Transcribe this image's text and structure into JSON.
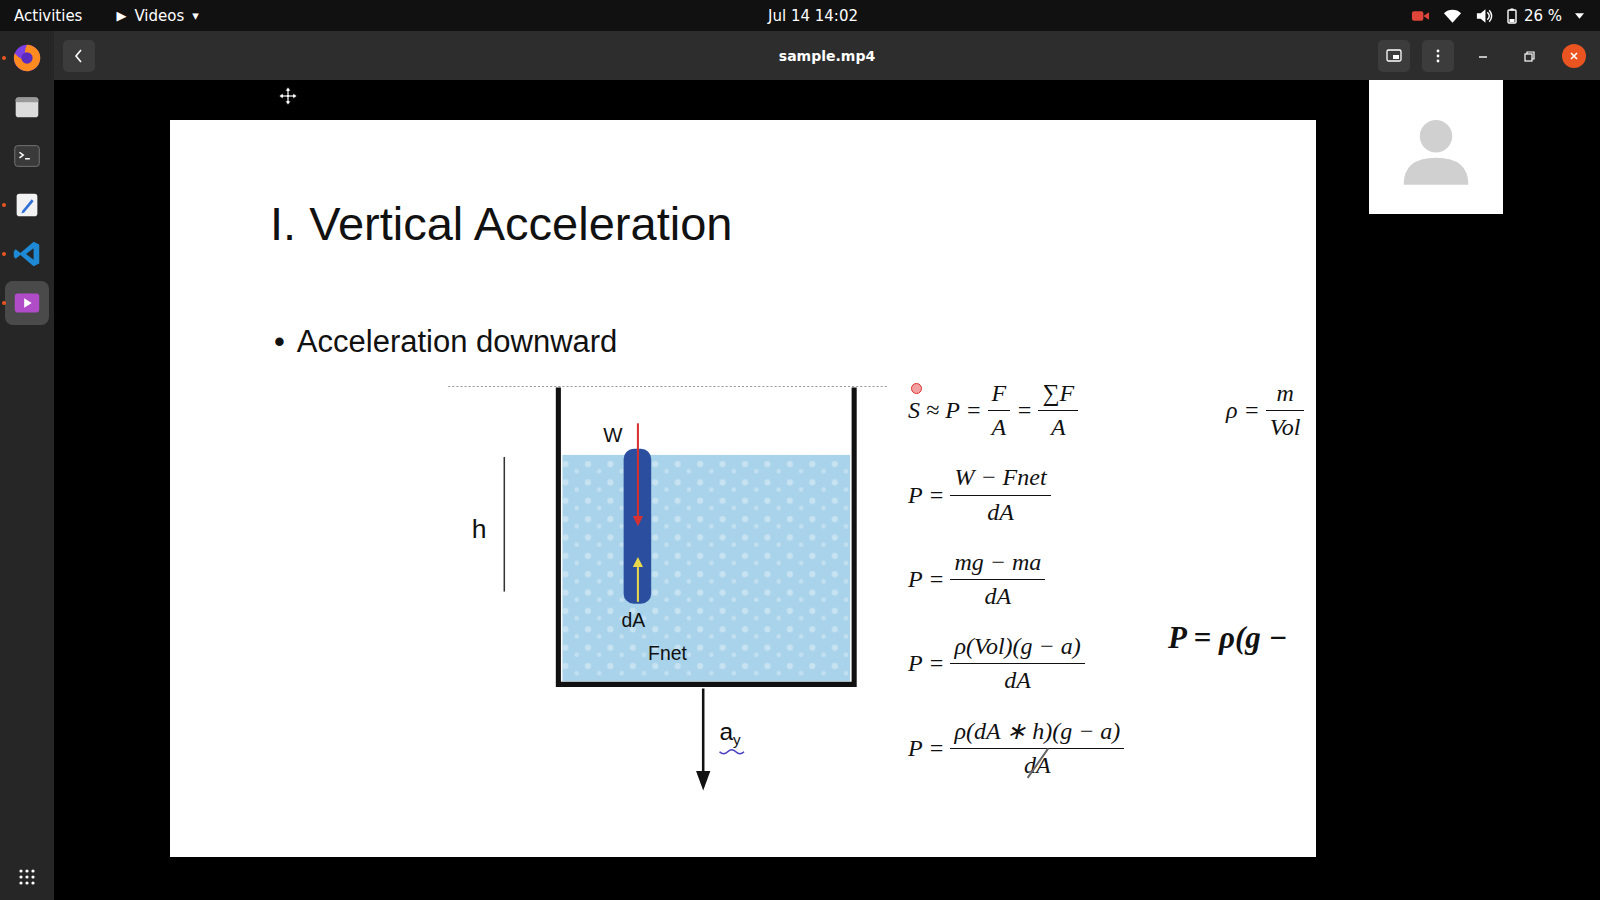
{
  "topbar": {
    "activities": "Activities",
    "app_menu": {
      "icon": "▶",
      "label": "Videos",
      "arrow": "▾"
    },
    "clock": "Jul 14  14:02",
    "battery": "26 %"
  },
  "dock": [
    {
      "kind": "firefox",
      "running": true,
      "selected": false
    },
    {
      "kind": "files",
      "running": false,
      "selected": false
    },
    {
      "kind": "terminal",
      "running": false,
      "selected": false
    },
    {
      "kind": "editor",
      "running": true,
      "selected": false
    },
    {
      "kind": "vscode",
      "running": true,
      "selected": false
    },
    {
      "kind": "videos",
      "running": true,
      "selected": true
    }
  ],
  "window": {
    "title": "sample.mp4"
  },
  "slide": {
    "title": "I. Vertical Acceleration",
    "bullet": {
      "marker": "•",
      "text": "Acceleration downward"
    },
    "diagram": {
      "weight": "W",
      "area": "dA",
      "force": "Fnet",
      "height": "h",
      "acceleration": {
        "base": "a",
        "sub": "y"
      }
    },
    "equations": [
      [
        {
          "kind": "text",
          "text": "S ≈ P ="
        },
        {
          "kind": "frac",
          "num": "F",
          "den": "A",
          "struck": false
        },
        {
          "kind": "text",
          "text": "="
        },
        {
          "kind": "frac",
          "num": "∑F",
          "den": "A",
          "struck": false
        }
      ],
      [
        {
          "kind": "text",
          "text": "P ="
        },
        {
          "kind": "frac",
          "num": "W − Fnet",
          "den": "dA",
          "struck": false
        }
      ],
      [
        {
          "kind": "text",
          "text": "P ="
        },
        {
          "kind": "frac",
          "num": "mg − ma",
          "den": "dA",
          "struck": false
        }
      ],
      [
        {
          "kind": "text",
          "text": "P ="
        },
        {
          "kind": "frac",
          "num": "ρ(Vol)(g − a)",
          "den": "dA",
          "struck": false
        }
      ],
      [
        {
          "kind": "text",
          "text": "P ="
        },
        {
          "kind": "frac",
          "num": "ρ(dA ∗ h)(g − a)",
          "den": "dA",
          "struck": true
        }
      ]
    ],
    "side_equation": [
      {
        "kind": "text",
        "text": "ρ ="
      },
      {
        "kind": "frac",
        "num": "m",
        "den": "Vol",
        "struck": false
      }
    ],
    "result": "P = ρ(g −"
  },
  "participants": [
    {
      "kind": "video"
    },
    {
      "kind": "avatar"
    },
    {
      "kind": "video"
    },
    {
      "kind": "video"
    },
    {
      "kind": "video"
    },
    {
      "kind": "video"
    }
  ]
}
